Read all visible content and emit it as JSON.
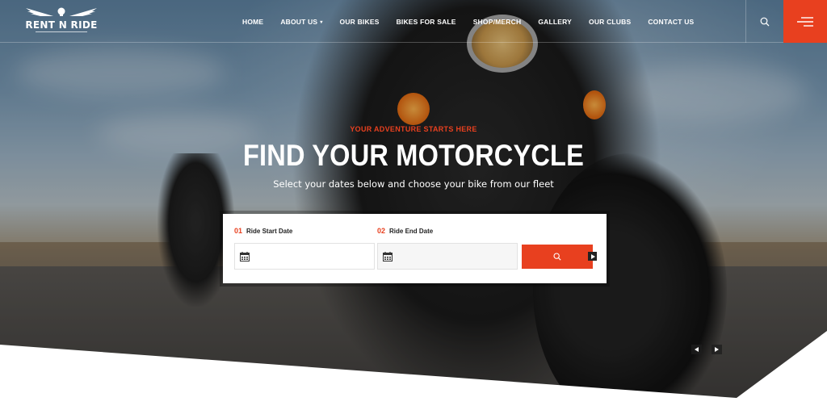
{
  "brand": {
    "name": "RENT N RIDE",
    "accent_color": "#e8401f"
  },
  "nav": {
    "items": [
      {
        "label": "HOME",
        "has_dropdown": false
      },
      {
        "label": "ABOUT US",
        "has_dropdown": true
      },
      {
        "label": "OUR BIKES",
        "has_dropdown": false
      },
      {
        "label": "BIKES FOR SALE",
        "has_dropdown": false
      },
      {
        "label": "SHOP/MERCH",
        "has_dropdown": false
      },
      {
        "label": "GALLERY",
        "has_dropdown": false
      },
      {
        "label": "OUR CLUBS",
        "has_dropdown": false
      },
      {
        "label": "CONTACT US",
        "has_dropdown": false
      }
    ],
    "search_icon": "search-icon",
    "menu_icon": "hamburger-menu-icon"
  },
  "hero": {
    "tagline": "YOUR ADVENTURE STARTS HERE",
    "title": "FIND YOUR MOTORCYCLE",
    "subtitle": "Select your dates below and choose your bike from our fleet"
  },
  "booking": {
    "start": {
      "number": "01",
      "label": "Ride Start Date",
      "value": "",
      "icon": "calendar-icon"
    },
    "end": {
      "number": "02",
      "label": "Ride End Date",
      "value": "",
      "icon": "calendar-icon"
    },
    "submit_icon": "search-icon"
  },
  "slider": {
    "prev_icon": "arrow-left-icon",
    "next_icon": "arrow-right-icon"
  }
}
